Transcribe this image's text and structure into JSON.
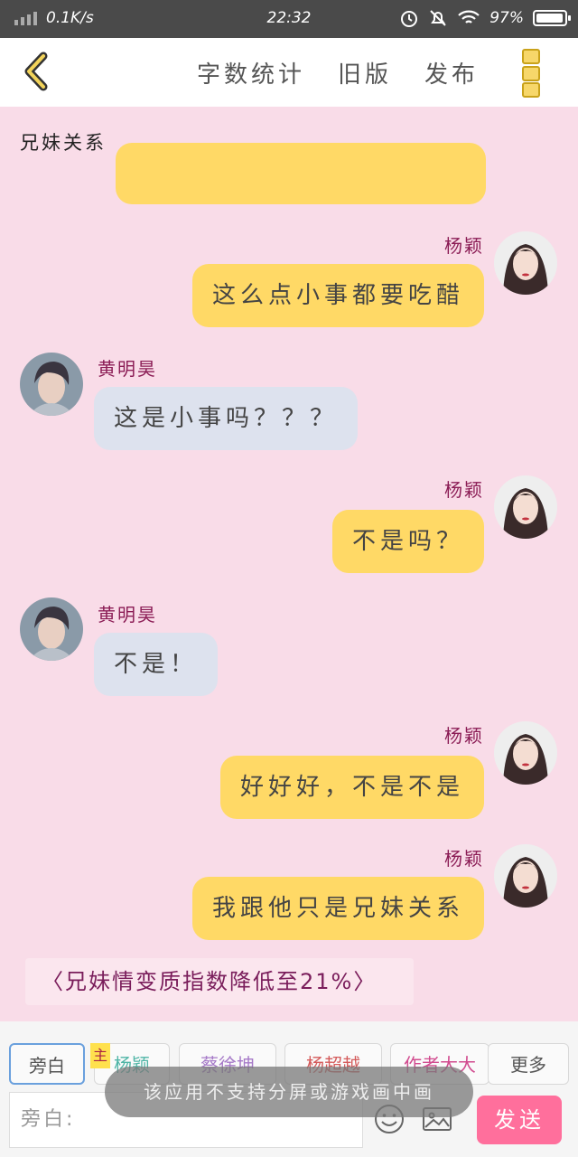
{
  "status_bar": {
    "network_speed": "0.1K/s",
    "time": "22:32",
    "battery": "97%",
    "battery_level": 0.97,
    "icons": [
      "signal-icon",
      "alarm-icon",
      "mute-icon",
      "wifi-icon",
      "battery-icon"
    ]
  },
  "header": {
    "back_icon": "chevron-left-icon",
    "actions": [
      "字数统计",
      "旧版",
      "发布"
    ],
    "menu_icon": "more-icon"
  },
  "chat": {
    "title": "兄妹关系",
    "messages": [
      {
        "side": "right",
        "sender": "",
        "text": ""
      },
      {
        "side": "right",
        "sender": "杨颖",
        "text": "这么点小事都要吃醋"
      },
      {
        "side": "left",
        "sender": "黄明昊",
        "text": "这是小事吗？？？"
      },
      {
        "side": "right",
        "sender": "杨颖",
        "text": "不是吗？"
      },
      {
        "side": "left",
        "sender": "黄明昊",
        "text": "不是！"
      },
      {
        "side": "right",
        "sender": "杨颖",
        "text": "好好好，不是不是"
      },
      {
        "side": "right",
        "sender": "杨颖",
        "text": "我跟他只是兄妹关系"
      }
    ],
    "narration": "〈兄妹情变质指数降低至21%〉"
  },
  "bottom_bar": {
    "roles": [
      {
        "label": "旁白",
        "color": "#555555",
        "selected": true
      },
      {
        "label": "杨颖",
        "color": "#4fb5a6",
        "selected": false
      },
      {
        "label": "蔡徐坤",
        "color": "#a67ac8",
        "selected": false
      },
      {
        "label": "杨超越",
        "color": "#d45a5a",
        "selected": false
      },
      {
        "label": "作者大大",
        "color": "#d14b8f",
        "selected": false
      },
      {
        "label": "更多",
        "color": "#555555",
        "selected": false
      }
    ],
    "main_badge": "主",
    "toast": "该应用不支持分屏或游戏画中画",
    "input_placeholder": "旁白:",
    "emoji_icon": "smiley-icon",
    "image_icon": "image-icon",
    "send_label": "发送",
    "send_color": "#ff6f9c"
  }
}
